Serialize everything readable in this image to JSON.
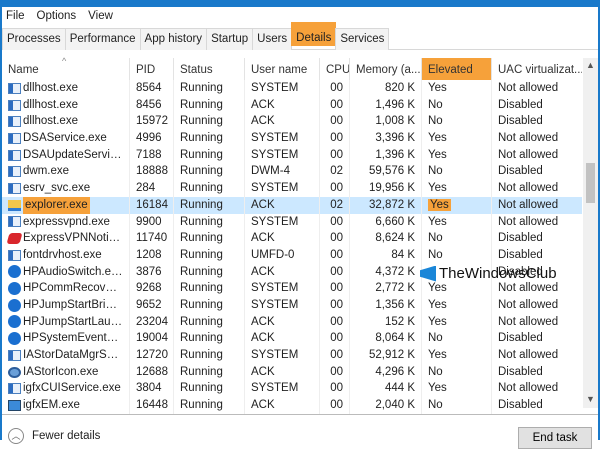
{
  "menu": [
    "File",
    "Options",
    "View"
  ],
  "tabs": [
    "Processes",
    "Performance",
    "App history",
    "Startup",
    "Users",
    "Details",
    "Services"
  ],
  "active_tab": "Details",
  "columns": [
    "Name",
    "PID",
    "Status",
    "User name",
    "CPU",
    "Memory (a...",
    "Elevated",
    "UAC virtualizat..."
  ],
  "rows": [
    {
      "icon": "app",
      "name": "dllhost.exe",
      "pid": "8564",
      "status": "Running",
      "user": "SYSTEM",
      "cpu": "00",
      "mem": "820 K",
      "elev": "Yes",
      "uac": "Not allowed"
    },
    {
      "icon": "app",
      "name": "dllhost.exe",
      "pid": "8456",
      "status": "Running",
      "user": "ACK",
      "cpu": "00",
      "mem": "1,496 K",
      "elev": "No",
      "uac": "Disabled"
    },
    {
      "icon": "app",
      "name": "dllhost.exe",
      "pid": "15972",
      "status": "Running",
      "user": "ACK",
      "cpu": "00",
      "mem": "1,008 K",
      "elev": "No",
      "uac": "Disabled"
    },
    {
      "icon": "app",
      "name": "DSAService.exe",
      "pid": "4996",
      "status": "Running",
      "user": "SYSTEM",
      "cpu": "00",
      "mem": "3,396 K",
      "elev": "Yes",
      "uac": "Not allowed"
    },
    {
      "icon": "app",
      "name": "DSAUpdateService.exe",
      "pid": "7188",
      "status": "Running",
      "user": "SYSTEM",
      "cpu": "00",
      "mem": "1,396 K",
      "elev": "Yes",
      "uac": "Not allowed"
    },
    {
      "icon": "app",
      "name": "dwm.exe",
      "pid": "18888",
      "status": "Running",
      "user": "DWM-4",
      "cpu": "02",
      "mem": "59,576 K",
      "elev": "No",
      "uac": "Disabled"
    },
    {
      "icon": "app",
      "name": "esrv_svc.exe",
      "pid": "284",
      "status": "Running",
      "user": "SYSTEM",
      "cpu": "00",
      "mem": "19,956 K",
      "elev": "Yes",
      "uac": "Not allowed"
    },
    {
      "icon": "folder",
      "name": "explorer.exe",
      "pid": "16184",
      "status": "Running",
      "user": "ACK",
      "cpu": "02",
      "mem": "32,872 K",
      "elev": "Yes",
      "uac": "Not allowed",
      "selected": true
    },
    {
      "icon": "app",
      "name": "expressvpnd.exe",
      "pid": "9900",
      "status": "Running",
      "user": "SYSTEM",
      "cpu": "00",
      "mem": "6,660 K",
      "elev": "Yes",
      "uac": "Not allowed"
    },
    {
      "icon": "vpn",
      "name": "ExpressVPNNotificat...",
      "pid": "11740",
      "status": "Running",
      "user": "ACK",
      "cpu": "00",
      "mem": "8,624 K",
      "elev": "No",
      "uac": "Disabled"
    },
    {
      "icon": "app",
      "name": "fontdrvhost.exe",
      "pid": "1208",
      "status": "Running",
      "user": "UMFD-0",
      "cpu": "00",
      "mem": "84 K",
      "elev": "No",
      "uac": "Disabled"
    },
    {
      "icon": "hp",
      "name": "HPAudioSwitch.exe",
      "pid": "3876",
      "status": "Running",
      "user": "ACK",
      "cpu": "00",
      "mem": "4,372 K",
      "elev": "",
      "uac": "Disabled"
    },
    {
      "icon": "hp",
      "name": "HPCommRecovery.e...",
      "pid": "9268",
      "status": "Running",
      "user": "SYSTEM",
      "cpu": "00",
      "mem": "2,772 K",
      "elev": "Yes",
      "uac": "Not allowed"
    },
    {
      "icon": "hp",
      "name": "HPJumpStartBridge....",
      "pid": "9652",
      "status": "Running",
      "user": "SYSTEM",
      "cpu": "00",
      "mem": "1,356 K",
      "elev": "Yes",
      "uac": "Not allowed"
    },
    {
      "icon": "hp",
      "name": "HPJumpStartLaunch....",
      "pid": "23204",
      "status": "Running",
      "user": "ACK",
      "cpu": "00",
      "mem": "152 K",
      "elev": "Yes",
      "uac": "Not allowed"
    },
    {
      "icon": "hp",
      "name": "HPSystemEventUtilit...",
      "pid": "19004",
      "status": "Running",
      "user": "ACK",
      "cpu": "00",
      "mem": "8,064 K",
      "elev": "No",
      "uac": "Disabled"
    },
    {
      "icon": "app",
      "name": "IAStorDataMgrSvc.exe",
      "pid": "12720",
      "status": "Running",
      "user": "SYSTEM",
      "cpu": "00",
      "mem": "52,912 K",
      "elev": "Yes",
      "uac": "Not allowed"
    },
    {
      "icon": "rst",
      "name": "IAStorIcon.exe",
      "pid": "12688",
      "status": "Running",
      "user": "ACK",
      "cpu": "00",
      "mem": "4,296 K",
      "elev": "No",
      "uac": "Disabled"
    },
    {
      "icon": "app",
      "name": "igfxCUIService.exe",
      "pid": "3804",
      "status": "Running",
      "user": "SYSTEM",
      "cpu": "00",
      "mem": "444 K",
      "elev": "Yes",
      "uac": "Not allowed"
    },
    {
      "icon": "em",
      "name": "igfxEM.exe",
      "pid": "16448",
      "status": "Running",
      "user": "ACK",
      "cpu": "00",
      "mem": "2,040 K",
      "elev": "No",
      "uac": "Disabled"
    }
  ],
  "footer": {
    "fewer_details": "Fewer details",
    "end_task": "End task"
  },
  "watermark": "TheWindowsClub",
  "colors": {
    "highlight": "#f6a13a",
    "titlebar": "#1979ca",
    "selected_row": "#cce8ff"
  }
}
